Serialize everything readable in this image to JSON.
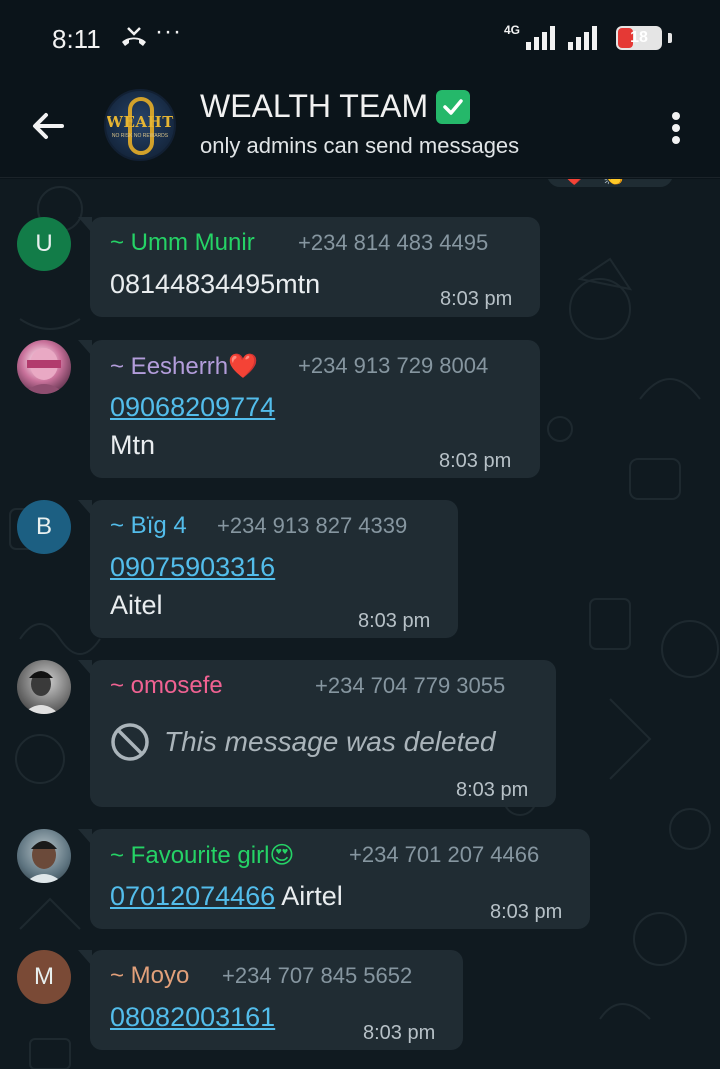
{
  "status_bar": {
    "time": "8:11",
    "more": "···",
    "network": "4G",
    "battery": "18",
    "battery_level": 0.18
  },
  "header": {
    "title": "WEALTH TEAM",
    "subtitle": "only admins can send messages",
    "avatar_text": "WEAHT",
    "avatar_subtext": "NO RISK NO REWARDS"
  },
  "colors": {
    "chat_bg": "#101a20",
    "bubble_bg": "#202c33",
    "link": "#53bdeb",
    "meta": "#8696a0"
  },
  "reactions": [
    "❤️",
    "👏"
  ],
  "messages": [
    {
      "sender": "~ Umm Munir",
      "sender_color": "#25d366",
      "phone": "+234 814 483 4495",
      "avatar_letter": "U",
      "avatar_color": "#127c48",
      "lines": [
        "08144834495mtn"
      ],
      "time": "8:03 pm"
    },
    {
      "sender": "~ Eesherrh❤️",
      "sender_color": "#b39ddb",
      "phone": "+234 913 729 8004",
      "avatar_letter": "",
      "lines": [
        "09068209774",
        "Mtn"
      ],
      "link_line": 0,
      "time": "8:03 pm"
    },
    {
      "sender": "~ Bïg 4",
      "sender_color": "#53bdeb",
      "phone": "+234 913 827 4339",
      "avatar_letter": "B",
      "avatar_color": "#1c5f82",
      "lines": [
        "09075903316",
        "Aitel"
      ],
      "link_line": 0,
      "time": "8:03 pm"
    },
    {
      "sender": "~ omosefe",
      "sender_color": "#f06292",
      "phone": "+234 704 779 3055",
      "avatar_letter": "",
      "deleted_text": "This message was deleted",
      "time": "8:03 pm"
    },
    {
      "sender": "~ Favourite girl😍",
      "sender_color": "#25d366",
      "phone": "+234 701 207 4466",
      "avatar_letter": "",
      "link_text": "07012074466",
      "after_link": " Airtel",
      "time": "8:03 pm"
    },
    {
      "sender": "~ Moyo",
      "sender_color": "#e2a07a",
      "phone": "+234 707 845 5652",
      "avatar_letter": "M",
      "avatar_color": "#7a4a36",
      "lines": [
        "08082003161"
      ],
      "link_line": 0,
      "time": "8:03 pm"
    }
  ]
}
